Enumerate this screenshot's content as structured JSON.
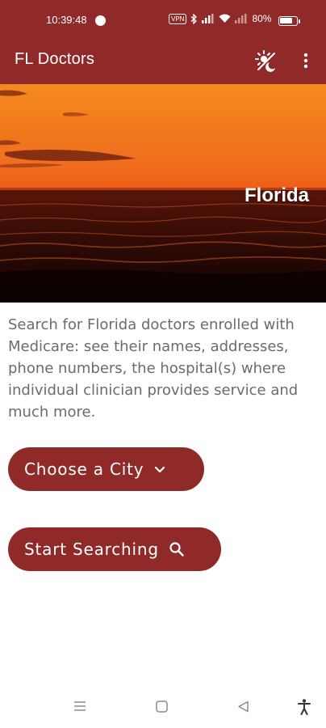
{
  "status_bar": {
    "time": "10:39:48",
    "vpn_label": "VPN",
    "battery_text": "80%",
    "battery_level": 0.8
  },
  "app_bar": {
    "title": "FL Doctors",
    "theme_icon": "brightness-auto-icon",
    "menu_icon": "more-vert-icon"
  },
  "hero": {
    "label": "Florida"
  },
  "description": "Search for Florida doctors enrolled with Medicare: see their names, addresses, phone numbers, the hospital(s) where individual clinician provides service and much more.",
  "buttons": {
    "choose_city": "Choose a City",
    "start_searching": "Start Searching"
  },
  "colors": {
    "primary": "#8f2a28",
    "text_secondary": "#6b6b6b"
  }
}
